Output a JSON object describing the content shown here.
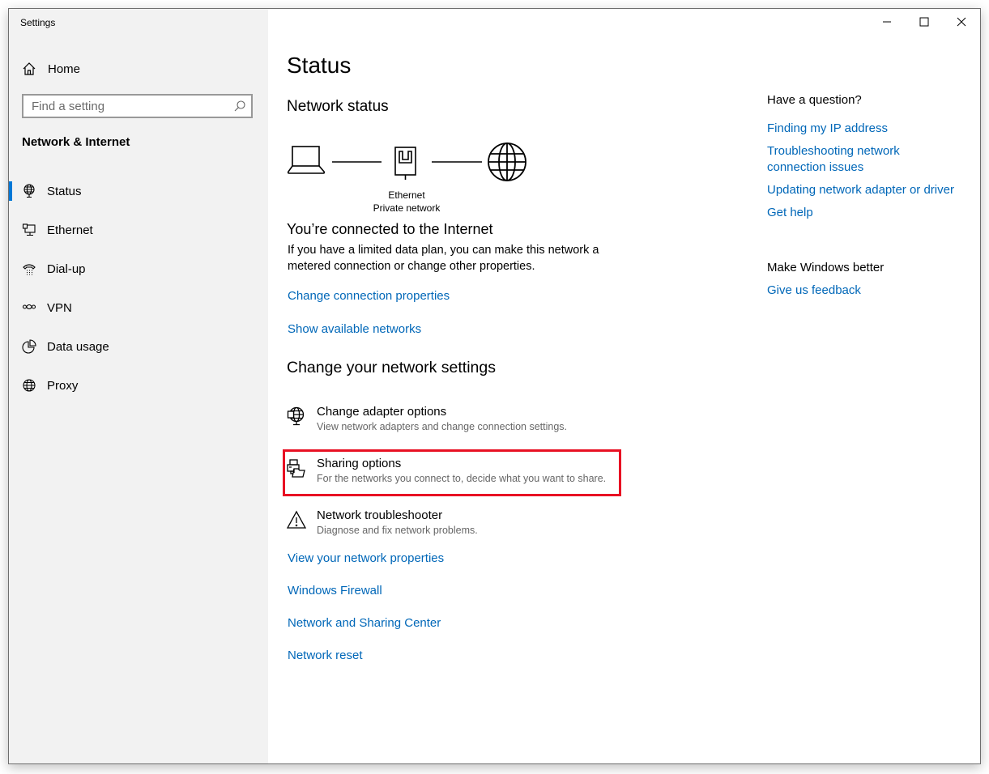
{
  "window": {
    "title": "Settings",
    "controls": {
      "minimize": "minimize",
      "maximize": "maximize",
      "close": "close"
    }
  },
  "sidebar": {
    "home_label": "Home",
    "search": {
      "placeholder": "Find a setting",
      "value": ""
    },
    "section_title": "Network & Internet",
    "items": [
      {
        "label": "Status",
        "icon": "status-globe-monitor-icon",
        "active": true
      },
      {
        "label": "Ethernet",
        "icon": "ethernet-icon",
        "active": false
      },
      {
        "label": "Dial-up",
        "icon": "dial-up-phone-icon",
        "active": false
      },
      {
        "label": "VPN",
        "icon": "vpn-icon",
        "active": false
      },
      {
        "label": "Data usage",
        "icon": "data-usage-pie-icon",
        "active": false
      },
      {
        "label": "Proxy",
        "icon": "proxy-globe-icon",
        "active": false
      }
    ]
  },
  "main": {
    "page_title": "Status",
    "network_status_heading": "Network status",
    "diagram": {
      "connection_type": "Ethernet",
      "network_profile": "Private network"
    },
    "connected_heading": "You’re connected to the Internet",
    "connected_description": "If you have a limited data plan, you can make this network a metered connection or change other properties.",
    "links_top": [
      "Change connection properties",
      "Show available networks"
    ],
    "change_settings_heading": "Change your network settings",
    "options": [
      {
        "title": "Change adapter options",
        "description": "View network adapters and change connection settings.",
        "icon": "adapter-icon"
      },
      {
        "title": "Sharing options",
        "description": "For the networks you connect to, decide what you want to share.",
        "icon": "sharing-icon",
        "highlighted": true
      },
      {
        "title": "Network troubleshooter",
        "description": "Diagnose and fix network problems.",
        "icon": "warning-icon"
      }
    ],
    "links_bottom": [
      "View your network properties",
      "Windows Firewall",
      "Network and Sharing Center",
      "Network reset"
    ],
    "highlight_color": "#e81123"
  },
  "related": {
    "question_heading": "Have a question?",
    "question_links": [
      "Finding my IP address",
      "Troubleshooting network connection issues",
      "Updating network adapter or driver",
      "Get help"
    ],
    "feedback_heading": "Make Windows better",
    "feedback_link": "Give us feedback"
  },
  "colors": {
    "accent": "#0078d7",
    "link": "#0067b8",
    "sidebar_bg": "#f2f2f2"
  }
}
